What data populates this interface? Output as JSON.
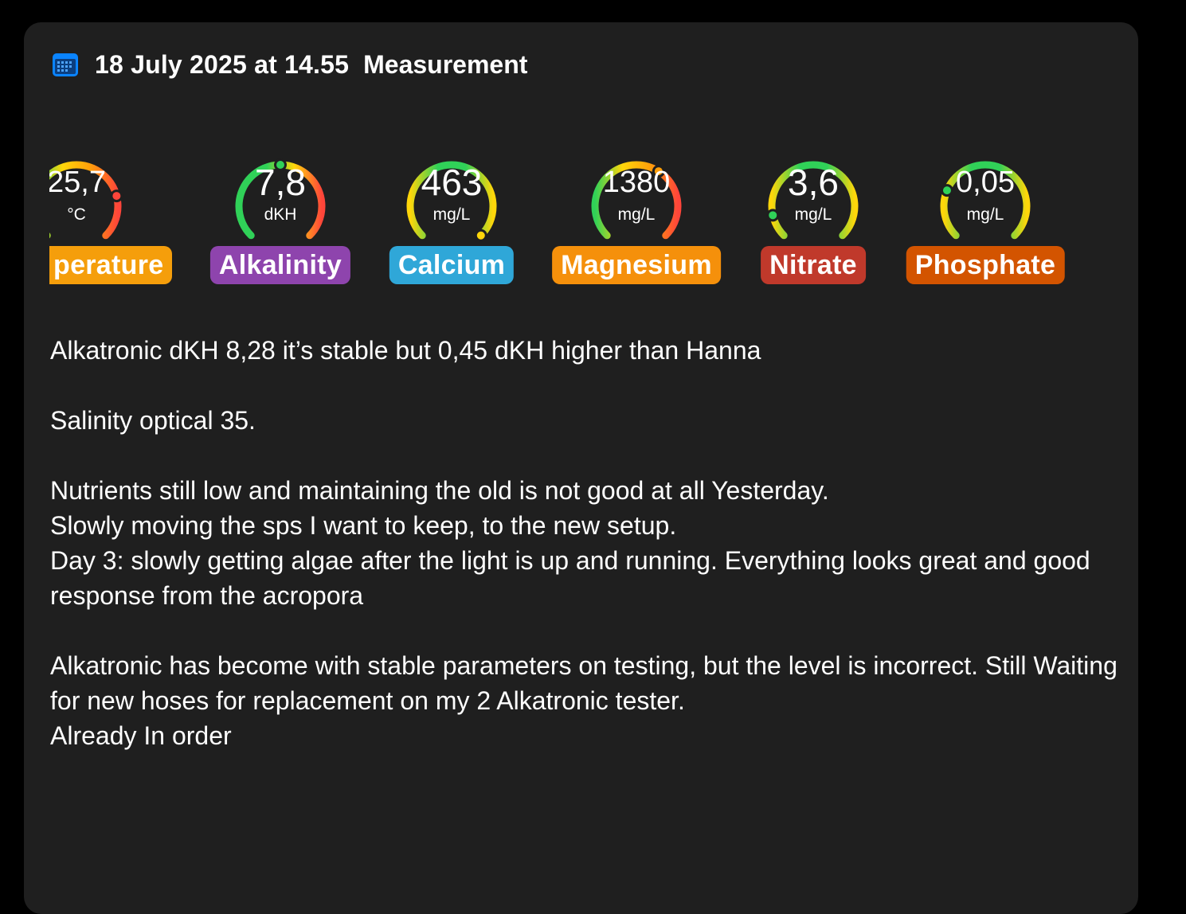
{
  "header": {
    "date": "18 July 2025 at 14.55",
    "kind": "Measurement",
    "icon": "calendar-icon"
  },
  "gauges": [
    {
      "id": "temperature",
      "value": "25,7",
      "unit": "°C",
      "label": "Temperature",
      "label_visible": "perature",
      "badge_color": "#f59e0b",
      "indicator_level": 0.78
    },
    {
      "id": "alkalinity",
      "value": "7,8",
      "unit": "dKH",
      "label": "Alkalinity",
      "badge_color": "#8e44ad",
      "indicator_level": 0.5
    },
    {
      "id": "calcium",
      "value": "463",
      "unit": "mg/L",
      "label": "Calcium",
      "badge_color": "#2fa7d8",
      "indicator_level": 1.0
    },
    {
      "id": "magnesium",
      "value": "1380",
      "unit": "mg/L",
      "label": "Magnesium",
      "badge_color": "#f5900b",
      "indicator_level": 0.62
    },
    {
      "id": "nitrate",
      "value": "3,6",
      "unit": "mg/L",
      "label": "Nitrate",
      "badge_color": "#c0392b",
      "indicator_level": 0.12
    },
    {
      "id": "phosphate",
      "value": "0,05",
      "unit": "mg/L",
      "label": "Phosphate",
      "badge_color": "#d35400",
      "indicator_level": 0.25
    }
  ],
  "notes": [
    "Alkatronic dKH 8,28 it’s stable but 0,45 dKH higher than Hanna",
    "Salinity optical 35.",
    "Nutrients still low and maintaining the old is not good at all Yesterday.\nSlowly moving the sps I want to keep, to the new setup.\nDay 3: slowly getting algae after the light is up and running. Everything looks great and good response from the acropora",
    "Alkatronic has become with stable parameters on testing, but the level is incorrect. Still Waiting for new hoses for replacement on my 2 Alkatronic tester.\nAlready In order"
  ],
  "colors": {
    "background": "#000000",
    "card": "#1f1f1f",
    "gauge_green": "#30d158",
    "gauge_yellow": "#ffd60a",
    "gauge_orange": "#ff9f0a",
    "gauge_red": "#ff453a",
    "icon_blue": "#0a84ff"
  }
}
